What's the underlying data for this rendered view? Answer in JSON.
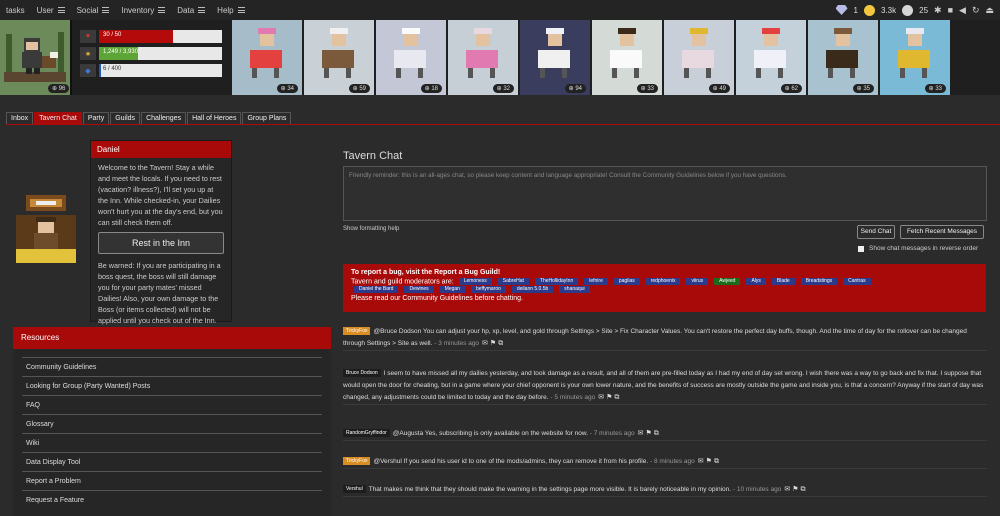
{
  "topnav": {
    "menus": [
      {
        "label": "tasks",
        "has_icon": false
      },
      {
        "label": "User",
        "has_icon": true
      },
      {
        "label": "Social",
        "has_icon": true
      },
      {
        "label": "Inventory",
        "has_icon": true
      },
      {
        "label": "Data",
        "has_icon": true
      },
      {
        "label": "Help",
        "has_icon": true
      }
    ],
    "gems": "1",
    "gold": "3.3k",
    "silver": "25"
  },
  "player": {
    "level": "96",
    "hp": "30 / 50",
    "exp": "1,249 / 3,930",
    "mp": "6 / 400",
    "hp_fraction": 0.6,
    "exp_fraction": 0.32,
    "mp_fraction": 0.015
  },
  "party": [
    {
      "level": "34",
      "bg": "#a6bcc9"
    },
    {
      "level": "59",
      "bg": "#c9d1d6"
    },
    {
      "level": "18",
      "bg": "#c3c7d6"
    },
    {
      "level": "32",
      "bg": "#c6cfd6"
    },
    {
      "level": "94",
      "bg": "#3b3d5e"
    },
    {
      "level": "33",
      "bg": "#d4dbd6"
    },
    {
      "level": "49",
      "bg": "#c8cfd8"
    },
    {
      "level": "62",
      "bg": "#c4d0da"
    },
    {
      "level": "35",
      "bg": "#a8c3cf"
    },
    {
      "level": "33",
      "bg": "#7bbad7"
    }
  ],
  "tabs": [
    "Inbox",
    "Tavern Chat",
    "Party",
    "Guilds",
    "Challenges",
    "Hall of Heroes",
    "Group Plans"
  ],
  "infocard": {
    "title": "Daniel",
    "welcome": "Welcome to the Tavern! Stay a while and meet the locals. If you need to rest (vacation? illness?), I'll set you up at the Inn. While checked-in, your Dailies won't hurt you at the day's end, but you can still check them off.",
    "rest_button": "Rest in the Inn",
    "warning": "Be warned: If you are participating in a boss quest, the boss will still damage you for your party mates' missed Dailies! Also, your own damage to the Boss (or items collected) will not be applied until you check out of the Inn."
  },
  "resources": {
    "title": "Resources",
    "items": [
      "Community Guidelines",
      "Looking for Group (Party Wanted) Posts",
      "FAQ",
      "Glossary",
      "Wiki",
      "Data Display Tool",
      "Report a Problem",
      "Request a Feature"
    ]
  },
  "chat": {
    "title": "Tavern Chat",
    "placeholder": "Friendly reminder: this is an all-ages chat, so please keep content and language appropriate! Consult the Community Guidelines below if you have questions.",
    "formatting_help": "Show formatting help",
    "send": "Send Chat",
    "fetch": "Fetch Recent Messages",
    "reverse_label": "Show chat messages in reverse order"
  },
  "banner": {
    "line1": "To report a bug, visit the Report a Bug Guild!",
    "line2": "Tavern and guild moderators are:",
    "mods_row1": [
      "Lemoness",
      "SabreHat",
      "TheHollidayInn",
      "lefnire",
      "paglias",
      "redphoenix",
      "viirus",
      "Awjeed",
      "Alys",
      "Blade",
      "Breadstings",
      "Cantras"
    ],
    "mods_row2": [
      "Daniel the Bard",
      "Dewines",
      "Megan",
      "beffymaroo",
      "deilann 5.0.5b",
      "shanaqui"
    ],
    "line3": "Please read our Community Guidelines before chatting."
  },
  "messages": [
    {
      "user": "TrickyFox",
      "style": "orange",
      "text": "@Bruce Dodson You can adjust your hp, xp, level, and gold through Settings > Site > Fix Character Values. You can't restore the perfect day buffs, though. And the time of day for the rollover can be changed through Settings > Site as well.",
      "time": " - 3 minutes ago"
    },
    {
      "user": "Bruce Dodson",
      "style": "dark",
      "text": "I seem to have missed all my dailies yesterday, and took damage as a result, and all of them are pre-filled today as I had my end of day set wrong. I wish there was a way to go back and fix that. I suppose that would open the door for cheating, but in a game where your chief opponent is your own lower nature, and the benefits of success are mostly outside the game and inside you, is that a concern? Anyway if the start of day was changed, any adjustments could be limited to today and the day before.",
      "time": " - 5 minutes ago"
    },
    {
      "user": "RandomGryffindor",
      "style": "dark",
      "text": "@Augusta Yes, subscribing is only available on the website for now.",
      "time": " - 7 minutes ago"
    },
    {
      "user": "TrickyFox",
      "style": "orange",
      "text": "@Vershul If you send his user id to one of the mods/admins, they can remove it from his profile.",
      "time": " - 8 minutes ago"
    },
    {
      "user": "Vershul",
      "style": "dark",
      "text": "That makes me think that they should make the warning in the settings page more visible. It is barely noticeable in my opinion.",
      "time": " - 10 minutes ago"
    }
  ]
}
